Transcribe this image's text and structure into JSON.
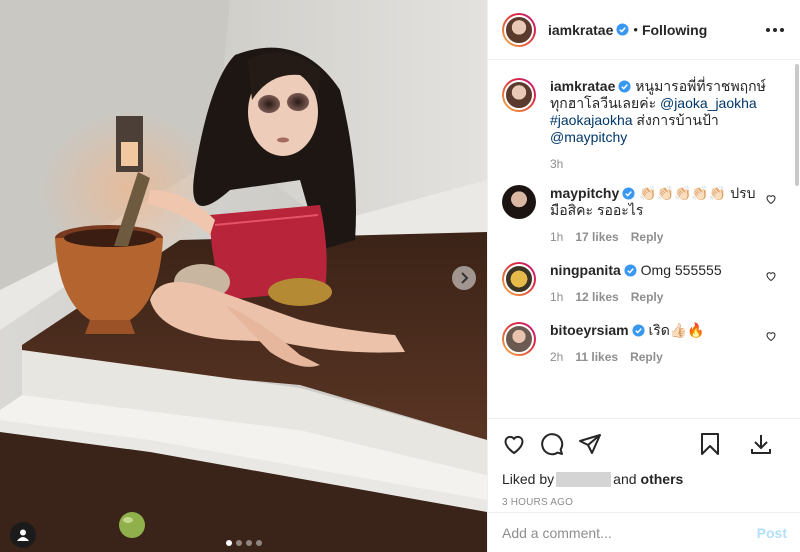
{
  "post": {
    "username": "iamkratae",
    "following_label": "Following",
    "separator": "•",
    "carousel": {
      "slides": 4,
      "active_index": 0
    }
  },
  "caption": {
    "username": "iamkratae",
    "text_before": "หนูมารอพี่ที่ราชพฤกษ์ทุกฮาโลวีนเลยค่ะ ",
    "mention1": "@jaoka_jaokha",
    "hashtag": "#jaokajaokha",
    "text_middle": " ส่งการบ้านป้า ",
    "mention2": "@maypitchy",
    "time": "3h"
  },
  "comments": [
    {
      "username": "maypitchy",
      "text": "👏🏻👏🏻👏🏻👏🏻👏🏻 ปรบมือสิคะ รออะไร",
      "time": "1h",
      "likes": "17 likes",
      "reply": "Reply"
    },
    {
      "username": "ningpanita",
      "text": "Omg 555555",
      "time": "1h",
      "likes": "12 likes",
      "reply": "Reply"
    },
    {
      "username": "bitoeyrsiam",
      "text": "เริด👍🏻🔥",
      "time": "2h",
      "likes": "11 likes",
      "reply": "Reply"
    }
  ],
  "likes": {
    "prefix": "Liked by",
    "suffix": "and",
    "others": "others"
  },
  "timestamp": "3 HOURS AGO",
  "add_comment": {
    "placeholder": "Add a comment...",
    "post_label": "Post"
  },
  "colors": {
    "link": "#00376b",
    "verified": "#3897f0",
    "post_button": "#b2dffc",
    "meta": "#8e8e8e"
  },
  "icons": [
    "verified-icon",
    "more-options-icon",
    "heart-icon",
    "comment-icon",
    "share-icon",
    "bookmark-icon",
    "download-icon",
    "next-arrow-icon",
    "user-tag-icon"
  ]
}
